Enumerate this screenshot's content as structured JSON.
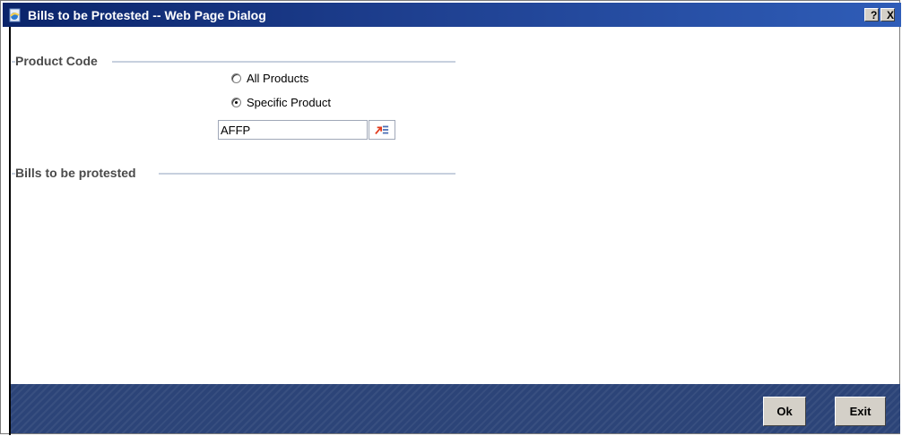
{
  "window": {
    "title": "Bills to be Protested -- Web Page Dialog",
    "help_label": "?",
    "close_label": "X"
  },
  "product_code": {
    "title": "Product Code",
    "options": [
      {
        "label": "All Products",
        "checked": false
      },
      {
        "label": "Specific Product",
        "checked": true
      }
    ],
    "product_value": "AFFP"
  },
  "bills": {
    "title": "Bills to be protested"
  },
  "footer": {
    "ok_label": "Ok",
    "exit_label": "Exit"
  }
}
